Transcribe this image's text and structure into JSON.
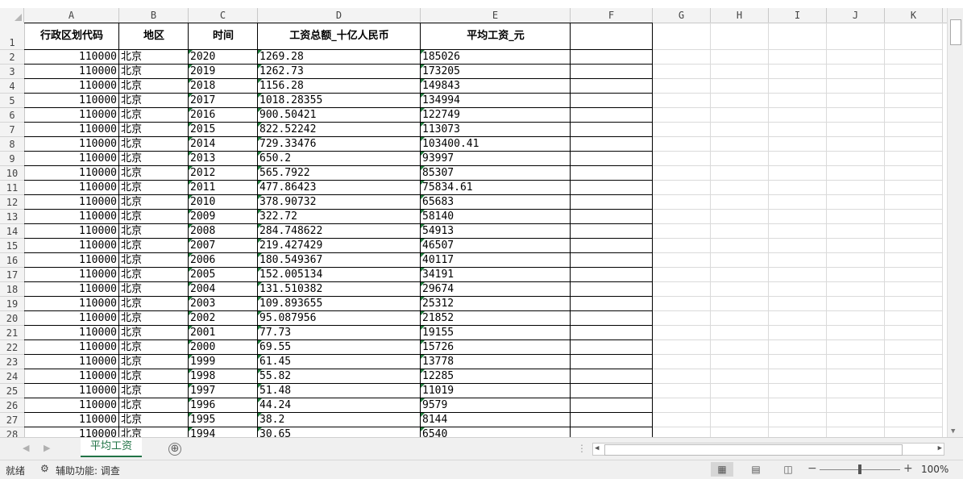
{
  "columns": [
    "A",
    "B",
    "C",
    "D",
    "E",
    "F",
    "G",
    "H",
    "I",
    "J",
    "K"
  ],
  "headers": {
    "code": "行政区划代码",
    "region": "地区",
    "year": "时间",
    "total_wage": "工资总额_十亿人民币",
    "avg_wage": "平均工资_元"
  },
  "row_numbers": [
    "1",
    "2",
    "3",
    "4",
    "5",
    "6",
    "7",
    "8",
    "9",
    "10",
    "11",
    "12",
    "13",
    "14",
    "15",
    "16",
    "17",
    "18",
    "19",
    "20",
    "21",
    "22",
    "23",
    "24",
    "25",
    "26",
    "27",
    "28"
  ],
  "rows": [
    {
      "code": "110000",
      "region": "北京",
      "year": "2020",
      "total": "1269.28",
      "avg": "185026"
    },
    {
      "code": "110000",
      "region": "北京",
      "year": "2019",
      "total": "1262.73",
      "avg": "173205"
    },
    {
      "code": "110000",
      "region": "北京",
      "year": "2018",
      "total": "1156.28",
      "avg": "149843"
    },
    {
      "code": "110000",
      "region": "北京",
      "year": "2017",
      "total": "1018.28355",
      "avg": "134994"
    },
    {
      "code": "110000",
      "region": "北京",
      "year": "2016",
      "total": "900.50421",
      "avg": "122749"
    },
    {
      "code": "110000",
      "region": "北京",
      "year": "2015",
      "total": "822.52242",
      "avg": "113073"
    },
    {
      "code": "110000",
      "region": "北京",
      "year": "2014",
      "total": "729.33476",
      "avg": "103400.41"
    },
    {
      "code": "110000",
      "region": "北京",
      "year": "2013",
      "total": "650.2",
      "avg": "93997"
    },
    {
      "code": "110000",
      "region": "北京",
      "year": "2012",
      "total": "565.7922",
      "avg": "85307"
    },
    {
      "code": "110000",
      "region": "北京",
      "year": "2011",
      "total": "477.86423",
      "avg": "75834.61"
    },
    {
      "code": "110000",
      "region": "北京",
      "year": "2010",
      "total": "378.90732",
      "avg": "65683"
    },
    {
      "code": "110000",
      "region": "北京",
      "year": "2009",
      "total": "322.72",
      "avg": "58140"
    },
    {
      "code": "110000",
      "region": "北京",
      "year": "2008",
      "total": "284.748622",
      "avg": "54913"
    },
    {
      "code": "110000",
      "region": "北京",
      "year": "2007",
      "total": "219.427429",
      "avg": "46507"
    },
    {
      "code": "110000",
      "region": "北京",
      "year": "2006",
      "total": "180.549367",
      "avg": "40117"
    },
    {
      "code": "110000",
      "region": "北京",
      "year": "2005",
      "total": "152.005134",
      "avg": "34191"
    },
    {
      "code": "110000",
      "region": "北京",
      "year": "2004",
      "total": "131.510382",
      "avg": "29674"
    },
    {
      "code": "110000",
      "region": "北京",
      "year": "2003",
      "total": "109.893655",
      "avg": "25312"
    },
    {
      "code": "110000",
      "region": "北京",
      "year": "2002",
      "total": "95.087956",
      "avg": "21852"
    },
    {
      "code": "110000",
      "region": "北京",
      "year": "2001",
      "total": "77.73",
      "avg": "19155"
    },
    {
      "code": "110000",
      "region": "北京",
      "year": "2000",
      "total": "69.55",
      "avg": "15726"
    },
    {
      "code": "110000",
      "region": "北京",
      "year": "1999",
      "total": "61.45",
      "avg": "13778"
    },
    {
      "code": "110000",
      "region": "北京",
      "year": "1998",
      "total": "55.82",
      "avg": "12285"
    },
    {
      "code": "110000",
      "region": "北京",
      "year": "1997",
      "total": "51.48",
      "avg": "11019"
    },
    {
      "code": "110000",
      "region": "北京",
      "year": "1996",
      "total": "44.24",
      "avg": "9579"
    },
    {
      "code": "110000",
      "region": "北京",
      "year": "1995",
      "total": "38.2",
      "avg": "8144"
    },
    {
      "code": "110000",
      "region": "北京",
      "year": "1994",
      "total": "30.65",
      "avg": "6540"
    }
  ],
  "sheet_tab": "平均工资",
  "add_sheet_glyph": "⊕",
  "status": {
    "ready": "就绪",
    "accessibility": "辅助功能: 调查",
    "zoom": "100%"
  },
  "icons": {
    "sheet_prev": "◀",
    "sheet_next": "▶",
    "scroll_left": "◀",
    "scroll_right": "▶",
    "scroll_down": "▼",
    "accessibility": "accessibility-icon",
    "view_normal": "grid-view-icon",
    "view_layout": "page-layout-icon",
    "view_break": "page-break-icon"
  },
  "colors": {
    "accent": "#217346",
    "flag": "#1e7a3a"
  }
}
